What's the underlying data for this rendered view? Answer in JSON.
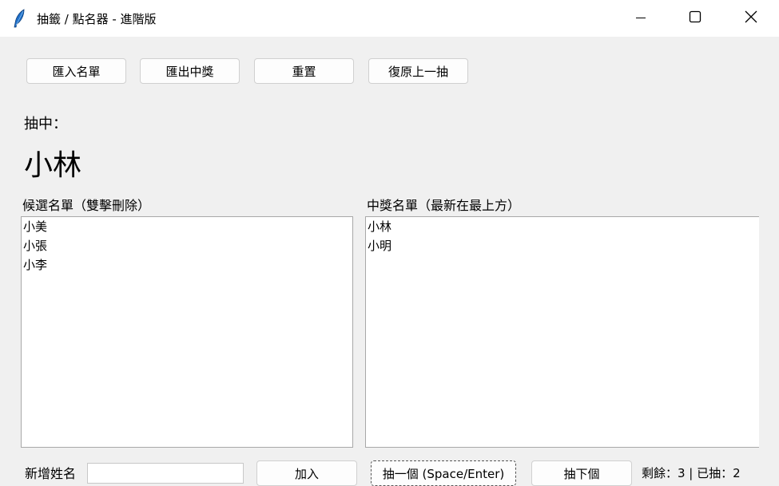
{
  "window": {
    "title": "抽籤 / 點名器 - 進階版",
    "icons": [
      "feather-icon",
      "minimize-icon",
      "maximize-icon",
      "close-icon"
    ]
  },
  "toolbar": {
    "import_label": "匯入名單",
    "export_label": "匯出中獎",
    "reset_label": "重置",
    "undo_label": "復原上一抽"
  },
  "picked": {
    "label": "抽中：",
    "name": "小林"
  },
  "candidates": {
    "label": "候選名單（雙擊刪除）",
    "items": [
      "小美",
      "小張",
      "小李"
    ]
  },
  "winners": {
    "label": "中獎名單（最新在最上方）",
    "items": [
      "小林",
      "小明"
    ]
  },
  "bottom": {
    "new_label": "新增姓名",
    "new_value": "",
    "add_label": "加入",
    "draw_one_label": "抽一個 (Space/Enter)",
    "draw_next_label": "抽下個",
    "remain_text": "剩餘：3 | 已抽：2"
  }
}
